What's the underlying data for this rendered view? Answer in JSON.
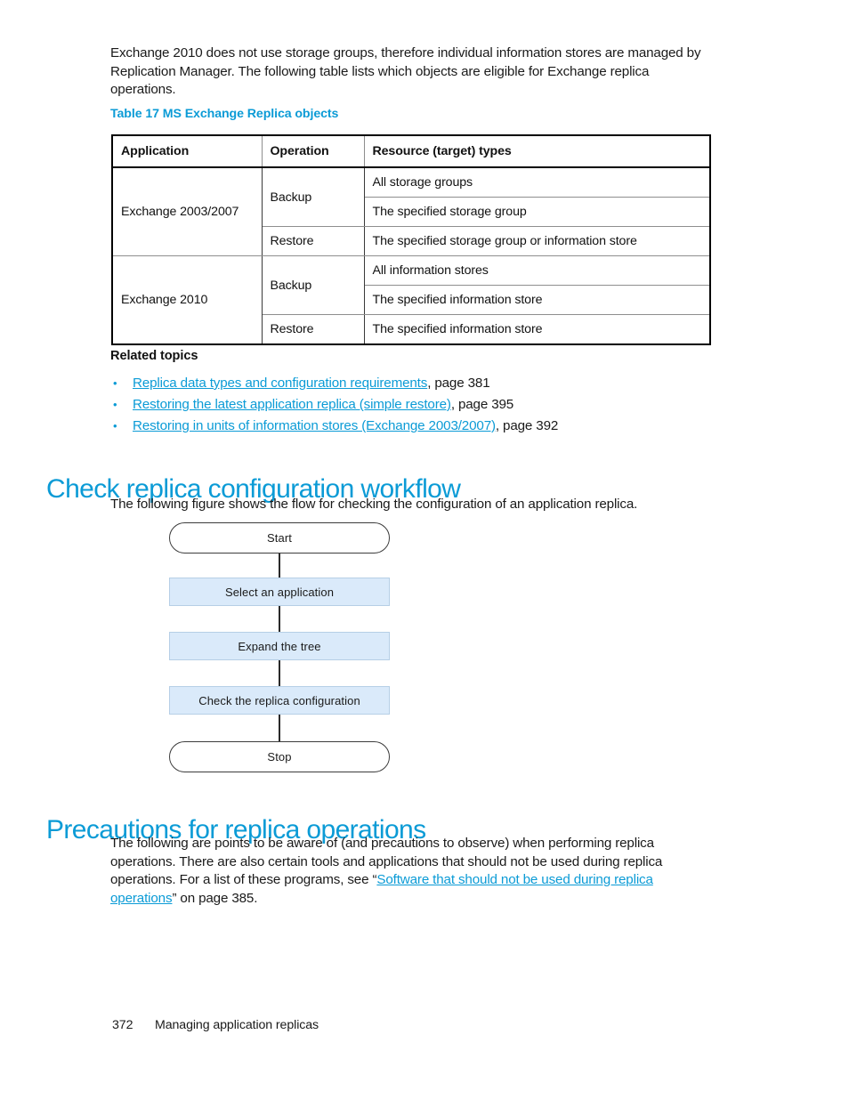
{
  "colors": {
    "accent_blue": "#0b9bd6",
    "flow_box_fill": "#daeafa",
    "flow_box_border": "#b6cfe6",
    "text": "#1a1a1a"
  },
  "intro": {
    "paragraph": "Exchange 2010 does not use storage groups, therefore individual information stores are managed by Replication Manager. The following table lists which objects are eligible for Exchange replica operations."
  },
  "table": {
    "caption": "Table 17 MS Exchange Replica objects",
    "headers": [
      "Application",
      "Operation",
      "Resource (target) types"
    ],
    "rows": [
      {
        "application": "Exchange 2003/2007",
        "operations": [
          {
            "operation": "Backup",
            "resources": [
              "All storage groups",
              "The specified storage group"
            ]
          },
          {
            "operation": "Restore",
            "resources": [
              "The specified storage group or information store"
            ]
          }
        ]
      },
      {
        "application": "Exchange 2010",
        "operations": [
          {
            "operation": "Backup",
            "resources": [
              "All information stores",
              "The specified information store"
            ]
          },
          {
            "operation": "Restore",
            "resources": [
              "The specified information store"
            ]
          }
        ]
      }
    ]
  },
  "related_topics": {
    "heading": "Related topics",
    "items": [
      {
        "bullet": "•",
        "link": "Replica data types and configuration requirements",
        "suffix": ", page 381"
      },
      {
        "bullet": "•",
        "link": "Restoring the latest application replica (simple restore)",
        "suffix": ", page 395"
      },
      {
        "bullet": "•",
        "link": "Restoring in units of information stores (Exchange 2003/2007)",
        "suffix": ", page 392"
      }
    ]
  },
  "section_check_replica": {
    "heading": "Check replica configuration workflow",
    "intro": "The following figure shows the flow for checking the configuration of an application replica.",
    "flowchart": {
      "nodes": [
        {
          "id": "start",
          "label": "Start",
          "shape": "terminator"
        },
        {
          "id": "select",
          "label": "Select an application",
          "shape": "process"
        },
        {
          "id": "expand",
          "label": "Expand the tree",
          "shape": "process"
        },
        {
          "id": "check",
          "label": "Check the replica configuration",
          "shape": "process"
        },
        {
          "id": "stop",
          "label": "Stop",
          "shape": "terminator"
        }
      ]
    }
  },
  "section_precautions": {
    "heading": "Precautions for replica operations",
    "text_part_1": "The following are points to be aware of (and precautions to observe) when performing replica operations. There are also certain tools and applications that should not be used during replica operations. For a list of these programs, see “",
    "link": "Software that should not be used during replica operations",
    "text_part_2": "” on page 385."
  },
  "footer": {
    "page_number": "372",
    "section_title": "Managing application replicas"
  }
}
